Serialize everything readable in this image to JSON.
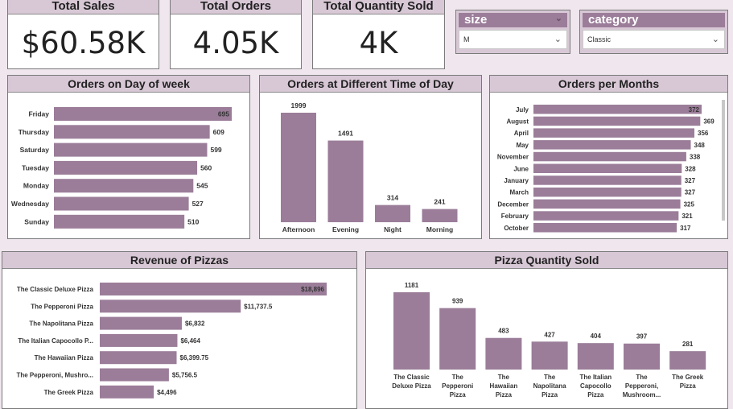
{
  "kpis": {
    "total_sales": {
      "label": "Total Sales",
      "value": "$60.58K"
    },
    "total_orders": {
      "label": "Total Orders",
      "value": "4.05K"
    },
    "total_quantity": {
      "label": "Total Quantity Sold",
      "value": "4K"
    }
  },
  "filters": {
    "size": {
      "title": "size",
      "value": "M"
    },
    "category": {
      "title": "category",
      "value": "Classic"
    }
  },
  "colors": {
    "bar": "#9b7d99",
    "header": "#d8c8d6"
  },
  "chart_data": [
    {
      "id": "dow",
      "type": "bar",
      "orientation": "horizontal",
      "title": "Orders on Day of week",
      "categories": [
        "Friday",
        "Thursday",
        "Saturday",
        "Tuesday",
        "Monday",
        "Wednesday",
        "Sunday"
      ],
      "values": [
        695,
        609,
        599,
        560,
        545,
        527,
        510
      ],
      "labels": [
        "695",
        "609",
        "599",
        "560",
        "545",
        "527",
        "510"
      ]
    },
    {
      "id": "tod",
      "type": "bar",
      "orientation": "vertical",
      "title": "Orders at Different Time of Day",
      "categories": [
        "Afternoon",
        "Evening",
        "Night",
        "Morning"
      ],
      "values": [
        1999,
        1491,
        314,
        241
      ],
      "labels": [
        "1999",
        "1491",
        "314",
        "241"
      ]
    },
    {
      "id": "months",
      "type": "bar",
      "orientation": "horizontal",
      "title": "Orders per Months",
      "categories": [
        "July",
        "August",
        "April",
        "May",
        "November",
        "June",
        "January",
        "March",
        "December",
        "February",
        "October"
      ],
      "values": [
        372,
        369,
        356,
        348,
        338,
        328,
        327,
        327,
        325,
        321,
        317
      ],
      "labels": [
        "372",
        "369",
        "356",
        "348",
        "338",
        "328",
        "327",
        "327",
        "325",
        "321",
        "317"
      ]
    },
    {
      "id": "revenue",
      "type": "bar",
      "orientation": "horizontal",
      "title": "Revenue of Pizzas",
      "categories": [
        "The Classic Deluxe Pizza",
        "The Pepperoni Pizza",
        "The Napolitana Pizza",
        "The Italian Capocollo P...",
        "The Hawaiian Pizza",
        "The Pepperoni, Mushro...",
        "The Greek Pizza"
      ],
      "values": [
        18896,
        11737.5,
        6832,
        6464,
        6399.75,
        5756.5,
        4496
      ],
      "labels": [
        "$18,896",
        "$11,737.5",
        "$6,832",
        "$6,464",
        "$6,399.75",
        "$5,756.5",
        "$4,496"
      ]
    },
    {
      "id": "quantity",
      "type": "bar",
      "orientation": "vertical",
      "title": "Pizza Quantity Sold",
      "categories": [
        "The Classic Deluxe Pizza",
        "The Pepperoni Pizza",
        "The Hawaiian Pizza",
        "The Napolitana Pizza",
        "The Italian Capocollo Pizza",
        "The Pepperoni, Mushroom...",
        "The Greek Pizza"
      ],
      "category_lines": [
        [
          "The Classic",
          "Deluxe Pizza"
        ],
        [
          "The",
          "Pepperoni",
          "Pizza"
        ],
        [
          "The",
          "Hawaiian",
          "Pizza"
        ],
        [
          "The",
          "Napolitana",
          "Pizza"
        ],
        [
          "The Italian",
          "Capocollo",
          "Pizza"
        ],
        [
          "The",
          "Pepperoni,",
          "Mushroom..."
        ],
        [
          "The Greek",
          "Pizza"
        ]
      ],
      "values": [
        1181,
        939,
        483,
        427,
        404,
        397,
        281
      ],
      "labels": [
        "1181",
        "939",
        "483",
        "427",
        "404",
        "397",
        "281"
      ]
    }
  ]
}
